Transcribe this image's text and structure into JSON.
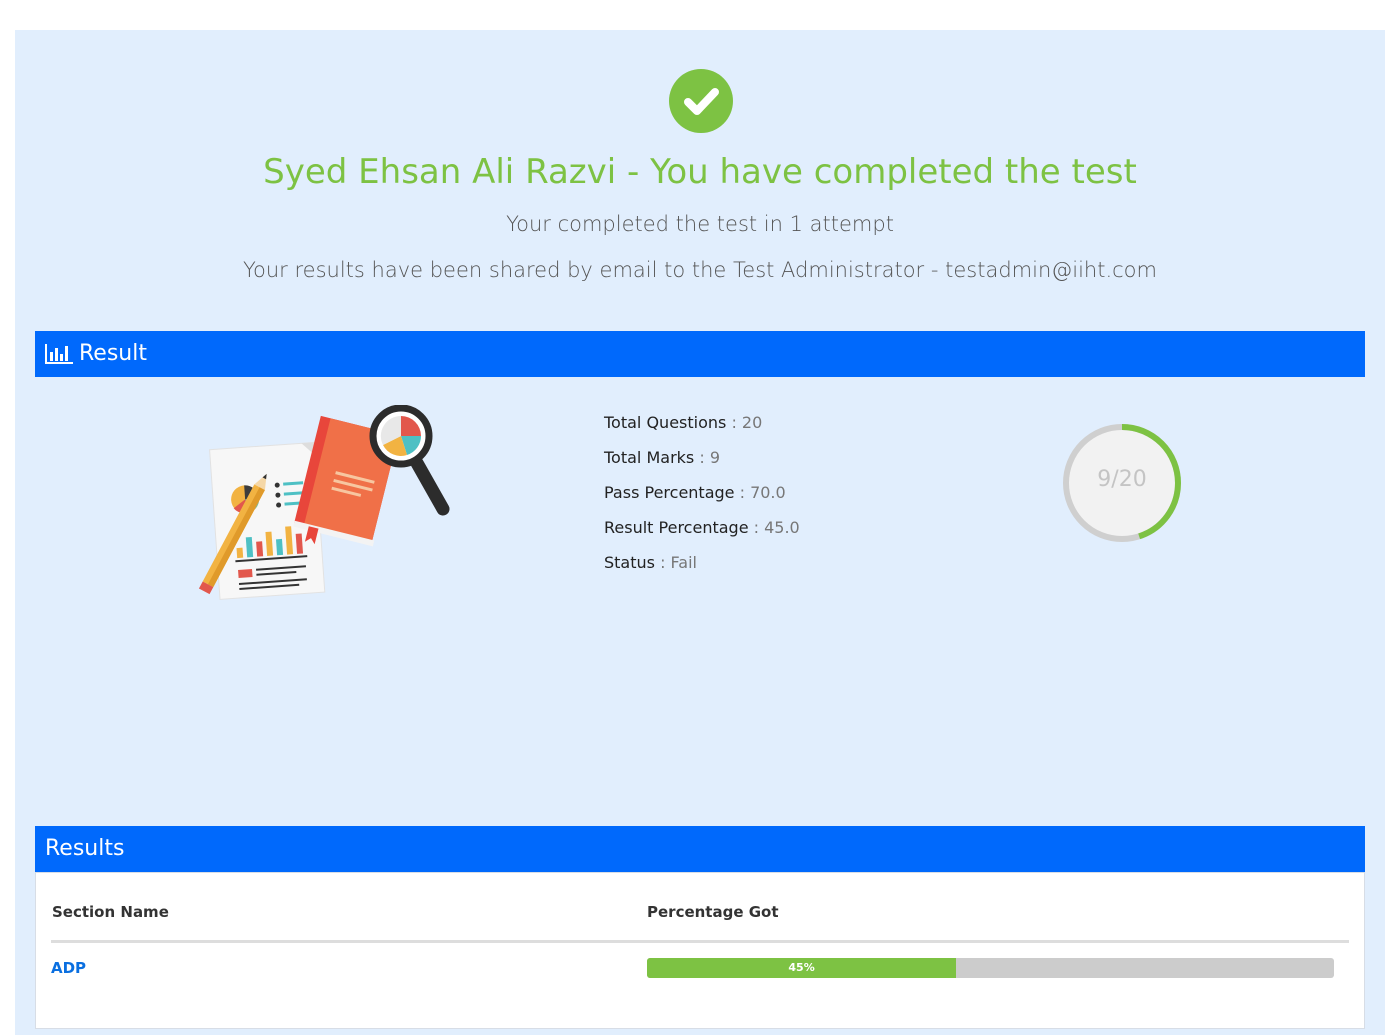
{
  "header": {
    "title": "Syed Ehsan Ali Razvi - You have completed the test",
    "attempt_text": "Your completed the test in 1 attempt",
    "shared_text": "Your results have been shared by email to the Test Administrator - testadmin@iiht.com",
    "status_icon": "check-icon",
    "accent_color": "#7dc243"
  },
  "result_panel": {
    "title": "Result",
    "icon": "bar-chart-icon",
    "stats": [
      {
        "label": "Total Questions",
        "value": "20"
      },
      {
        "label": "Total Marks",
        "value": "9"
      },
      {
        "label": "Pass Percentage",
        "value": "70.0"
      },
      {
        "label": "Result Percentage",
        "value": "45.0"
      },
      {
        "label": "Status",
        "value": "Fail"
      }
    ],
    "score_label": "9/20",
    "score_fraction": 0.45
  },
  "results_panel": {
    "title": "Results",
    "columns": [
      "Section Name",
      "Percentage Got"
    ],
    "rows": [
      {
        "section": "ADP",
        "percentage_label": "45%",
        "percentage": 45
      }
    ]
  },
  "colors": {
    "header_bar": "#0069fc",
    "panel_bg": "#e1eefd",
    "progress_fill": "#7dc243",
    "progress_track": "#cccccc"
  }
}
